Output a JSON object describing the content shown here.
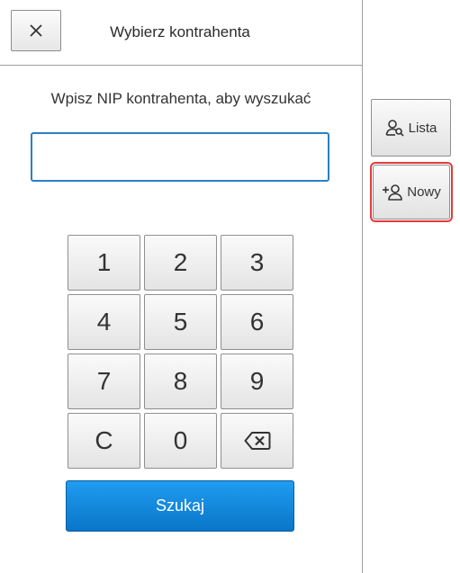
{
  "header": {
    "title": "Wybierz kontrahenta",
    "close_icon": "close-icon"
  },
  "prompt": "Wpisz NIP kontrahenta, aby wyszukać",
  "nip_input": {
    "value": "",
    "placeholder": ""
  },
  "keypad": {
    "keys": [
      "1",
      "2",
      "3",
      "4",
      "5",
      "6",
      "7",
      "8",
      "9",
      "C",
      "0"
    ],
    "backspace_icon": "backspace-icon"
  },
  "search_button": {
    "label": "Szukaj"
  },
  "side_panel": {
    "lista": {
      "label": "Lista",
      "icon": "user-search-icon"
    },
    "nowy": {
      "label": "Nowy",
      "icon": "user-add-icon"
    }
  },
  "colors": {
    "accent": "#0a76c9",
    "input_border": "#2a7fc6",
    "focus_highlight": "#e23b3b"
  }
}
